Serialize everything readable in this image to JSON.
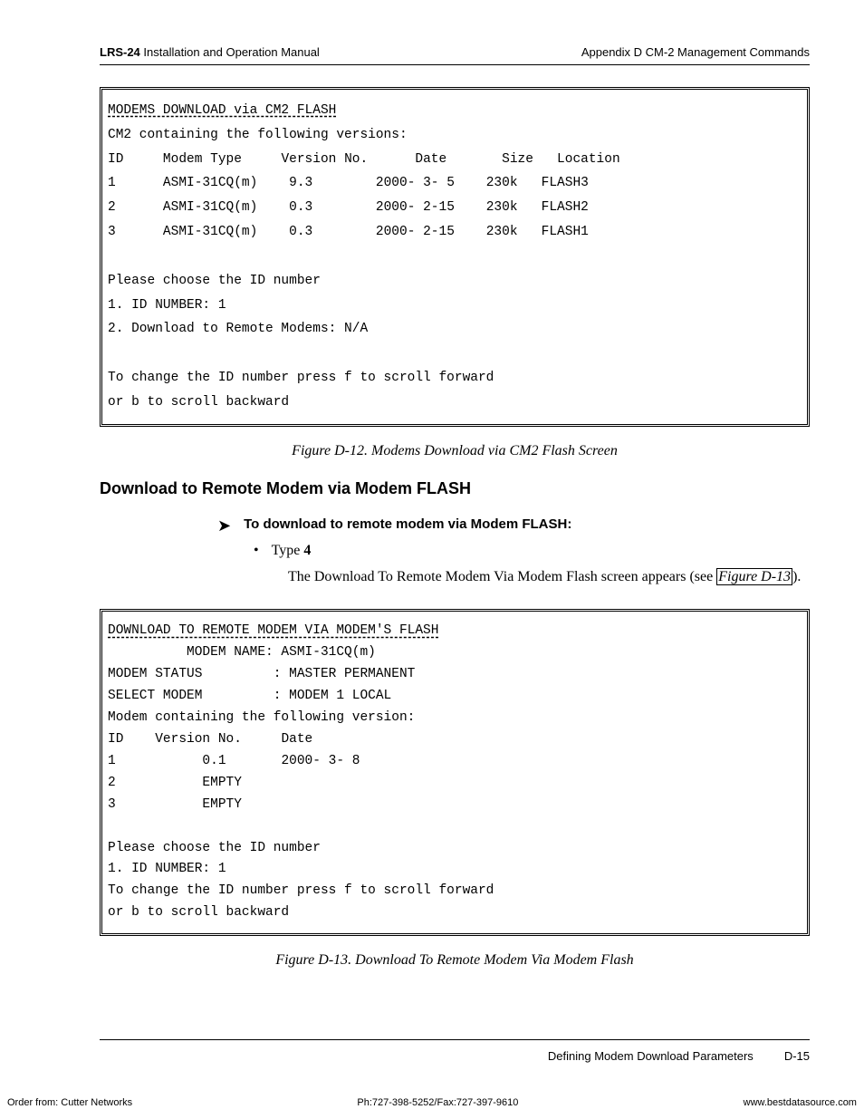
{
  "header": {
    "product": "LRS-24",
    "doc": "Installation and Operation Manual",
    "appendix": "Appendix D  CM-2 Management Commands"
  },
  "screen1": {
    "title": "MODEMS DOWNLOAD via CM2 FLASH",
    "subtitle": "CM2 containing the following versions:",
    "cols": {
      "c1": "ID",
      "c2": "Modem Type",
      "c3": "Version No.",
      "c4": "Date",
      "c5": "Size",
      "c6": "Location"
    },
    "rows": [
      {
        "id": "1",
        "type": "ASMI-31CQ(m)",
        "ver": "9.3",
        "date": "2000- 3- 5",
        "size": "230k",
        "loc": "FLASH3"
      },
      {
        "id": "2",
        "type": "ASMI-31CQ(m)",
        "ver": "0.3",
        "date": "2000- 2-15",
        "size": "230k",
        "loc": "FLASH2"
      },
      {
        "id": "3",
        "type": "ASMI-31CQ(m)",
        "ver": "0.3",
        "date": "2000- 2-15",
        "size": "230k",
        "loc": "FLASH1"
      }
    ],
    "p1": "Please choose the ID number",
    "p2": "1. ID NUMBER: 1",
    "p3": "2. Download to Remote Modems: N/A",
    "p4": "To change the ID number press f to scroll forward",
    "p5": "or b to scroll backward"
  },
  "caption1": "Figure D-12.  Modems Download via CM2 Flash Screen",
  "sectionHeading": "Download to Remote Modem via Modem FLASH",
  "procedure": "To download to remote modem via Modem FLASH:",
  "bullet_pre": "Type ",
  "bullet_bold": "4",
  "paragraph_pre": "The Download To Remote Modem Via Modem Flash screen appears (see ",
  "paragraph_ref": "Figure D-13",
  "paragraph_post": ").",
  "screen2": {
    "title": "DOWNLOAD TO REMOTE MODEM VIA MODEM'S FLASH",
    "l1": "          MODEM NAME: ASMI-31CQ(m)",
    "l2": "MODEM STATUS         : MASTER PERMANENT",
    "l3": "SELECT MODEM         : MODEM 1 LOCAL",
    "l4": "Modem containing the following version:",
    "cols": {
      "c1": "ID",
      "c2": "Version No.",
      "c3": "Date"
    },
    "rows": [
      {
        "id": "1",
        "ver": "0.1",
        "date": "2000- 3- 8"
      },
      {
        "id": "2",
        "ver": "EMPTY",
        "date": ""
      },
      {
        "id": "3",
        "ver": "EMPTY",
        "date": ""
      }
    ],
    "p1": "Please choose the ID number",
    "p2": "1. ID NUMBER: 1",
    "p3": "To change the ID number press f to scroll forward",
    "p4": "or b to scroll backward"
  },
  "caption2": "Figure D-13. Download To Remote Modem Via Modem Flash",
  "footer": {
    "section": "Defining Modem Download Parameters",
    "page": "D-15"
  },
  "vendor": {
    "left": "Order from: Cutter Networks",
    "mid": "Ph:727-398-5252/Fax:727-397-9610",
    "right": "www.bestdatasource.com"
  }
}
